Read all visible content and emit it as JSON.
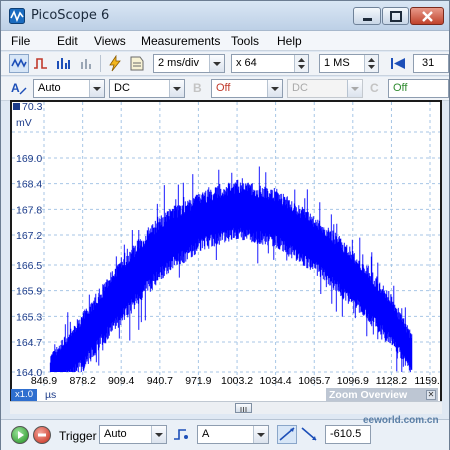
{
  "window": {
    "title": "PicoScope 6"
  },
  "menu": [
    "File",
    "Edit",
    "Views",
    "Measurements",
    "Tools",
    "Help"
  ],
  "toolbar1": {
    "timebase": "2 ms/div",
    "zoom": "x 64",
    "samples": "1 MS",
    "captures": "31"
  },
  "toolbar2": {
    "channel_a_range": "Auto",
    "channel_a_coupling": "DC",
    "channel_b_range": "Off",
    "channel_b_coupling": "DC",
    "channel_c_range": "Off"
  },
  "scope": {
    "y_unit": "mV",
    "x_unit": "µs",
    "zoom_factor": "x1.0",
    "zoom_overview": "Zoom Overview"
  },
  "chart_data": {
    "type": "line",
    "title": "",
    "xlabel": "µs",
    "ylabel": "mV",
    "x_ticks": [
      "846.9",
      "878.2",
      "909.4",
      "940.7",
      "971.9",
      "1003.2",
      "1034.4",
      "1065.7",
      "1096.9",
      "1128.2",
      "1159.4"
    ],
    "y_ticks": [
      "70.3",
      "169.0",
      "168.4",
      "167.8",
      "167.2",
      "166.5",
      "165.9",
      "165.3",
      "164.7",
      "164.0"
    ],
    "xlim": [
      846.9,
      1159.4
    ],
    "ylim": [
      164.0,
      169.0
    ],
    "grid": true,
    "series": [
      {
        "color": "#0000ff",
        "envelope_x": [
          852,
          878.2,
          909.4,
          940.7,
          971.9,
          1003.2,
          1034.4,
          1065.7,
          1096.9,
          1128.2,
          1145
        ],
        "envelope_center": [
          164.0,
          164.7,
          165.9,
          166.9,
          167.5,
          167.8,
          167.6,
          167.0,
          166.2,
          165.2,
          164.4
        ],
        "envelope_halfwidth": [
          0.4,
          0.7,
          0.8,
          0.8,
          0.7,
          0.7,
          0.7,
          0.7,
          0.7,
          0.6,
          0.5
        ]
      }
    ]
  },
  "trigger": {
    "label": "Trigger",
    "mode": "Auto",
    "source": "A",
    "level": "-610.5"
  },
  "watermark": "eeworld.com.cn",
  "colors": {
    "trace": "#0000ff",
    "axis_labels": "#1d3c8a",
    "grid": "#a7c6e6"
  }
}
